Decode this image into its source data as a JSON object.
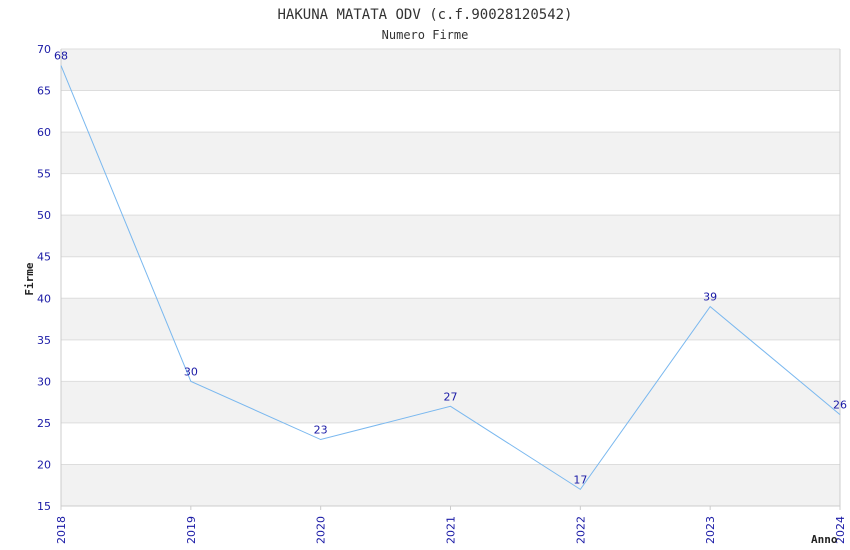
{
  "colors": {
    "band": "#f2f2f2",
    "grid": "#dddddd",
    "line": "#7ab8ef",
    "tick_text": "#1a1aa6",
    "axis": "#cccccc"
  },
  "chart_data": {
    "type": "line",
    "title": "HAKUNA MATATA ODV (c.f.90028120542)",
    "subtitle": "Numero Firme",
    "xlabel": "Anno",
    "ylabel": "Firme",
    "x": [
      "2018",
      "2019",
      "2020",
      "2021",
      "2022",
      "2023",
      "2024"
    ],
    "series": [
      {
        "values": [
          68,
          30,
          23,
          27,
          17,
          39,
          26
        ]
      }
    ],
    "data_labels": [
      "68",
      "30",
      "23",
      "27",
      "17",
      "39",
      "26"
    ],
    "ylim": [
      15,
      70
    ],
    "yticks": [
      15,
      20,
      25,
      30,
      35,
      40,
      45,
      50,
      55,
      60,
      65,
      70
    ],
    "grid": true,
    "alternating_bands": true,
    "legend": "none"
  }
}
